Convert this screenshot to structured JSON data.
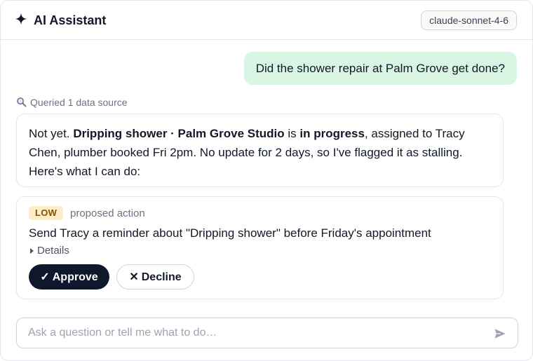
{
  "header": {
    "title": "AI Assistant",
    "model": "claude-sonnet-4-6",
    "icon": "sparkle-icon"
  },
  "conversation": {
    "user_message": "Did the shower repair at Palm Grove get done?",
    "queried_label": "Queried 1 data source",
    "assistant_message": {
      "t1": "Not yet. ",
      "b1": "Dripping shower · Palm Grove Studio",
      "t2": " is ",
      "b2": "in progress",
      "t3": ", assigned to Tracy Chen, plumber booked Fri 2pm. No update for 2 days, so I've flagged it as stalling. Here's what I can do:"
    }
  },
  "action": {
    "risk": "LOW",
    "risk_colors": {
      "bg": "#fdefc3",
      "fg": "#8a4b08"
    },
    "label": "proposed action",
    "text": "Send Tracy a reminder about \"Dripping shower\" before Friday's appointment",
    "details_label": "Details",
    "approve_icon": "✓",
    "approve_label": "Approve",
    "decline_icon": "✕",
    "decline_label": "Decline"
  },
  "composer": {
    "placeholder": "Ask a question or tell me what to do…",
    "value": ""
  },
  "colors": {
    "user_bubble": "#d9f5e3",
    "primary_button": "#0f172a"
  }
}
